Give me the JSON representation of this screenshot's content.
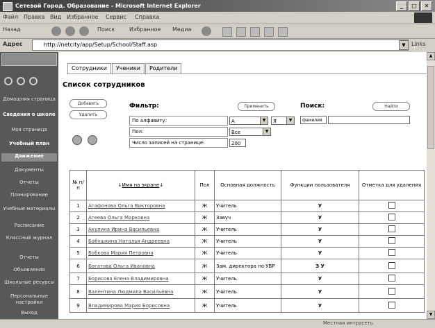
{
  "window": {
    "title": "Сетевой Город. Образование - Microsoft Internet Explorer",
    "min": "_",
    "max": "□",
    "close": "✕"
  },
  "menu": [
    "Файл",
    "Правка",
    "Вид",
    "Избранное",
    "Сервис",
    "Справка"
  ],
  "toolbar": {
    "back": "Назад",
    "search": "Поиск",
    "favorites": "Избранное",
    "media": "Медиа"
  },
  "address": {
    "label": "Адрес",
    "url": "http://netcity/app/Setup/School/Staff.asp",
    "go": "Links"
  },
  "sidebar": {
    "items": [
      {
        "label": "Домашняя страница"
      },
      {
        "label": "Сведения о школе"
      },
      {
        "label": "Моя страница"
      },
      {
        "label": "Учебный план"
      },
      {
        "label": "Движение"
      },
      {
        "label": "Документы"
      },
      {
        "label": "Отчеты"
      },
      {
        "label": "Планирование"
      },
      {
        "label": "Учебные материалы"
      },
      {
        "label": "Расписание"
      },
      {
        "label": "Классный журнал"
      },
      {
        "label": "Отчеты"
      },
      {
        "label": "Объявления"
      },
      {
        "label": "Школьные ресурсы"
      },
      {
        "label": "Персональные настройки"
      },
      {
        "label": "Выход"
      }
    ]
  },
  "tabs": [
    "Сотрудники",
    "Ученики",
    "Родители"
  ],
  "page": {
    "title": "Список сотрудников",
    "buttons": {
      "add": "Добавить",
      "delete": "Удалить",
      "apply": "Применить",
      "find": "Найти"
    },
    "filter": {
      "label": "Фильтр:",
      "alphabet_label": "По алфавиту:",
      "alphabet_from": "А",
      "alphabet_to": "Я",
      "sex_label": "Пол:",
      "sex_value": "Все",
      "rows_label": "Число записей на странице:",
      "rows_value": "200"
    },
    "search": {
      "label": "Поиск:",
      "field_select": "фамилия",
      "field_value": ""
    }
  },
  "table": {
    "headers": {
      "num": "№ п/п",
      "name": "Имя на экране",
      "sex": "Пол",
      "position": "Основная должность",
      "functions": "Функции пользователя",
      "delete": "Отметка для удаления"
    },
    "rows": [
      {
        "num": "1",
        "name": "Агафонова Ольга Викторовна",
        "sex": "Ж",
        "position": "Учитель",
        "func": "У"
      },
      {
        "num": "2",
        "name": "Агеева Ольга Марковна",
        "sex": "Ж",
        "position": "Завуч",
        "func": "У"
      },
      {
        "num": "3",
        "name": "Акулина Ирина Васильевна",
        "sex": "Ж",
        "position": "Учитель",
        "func": "У"
      },
      {
        "num": "4",
        "name": "Бабушкина Наталья Андреевна",
        "sex": "Ж",
        "position": "Учитель",
        "func": "У"
      },
      {
        "num": "5",
        "name": "Бобкова Мария Петровна",
        "sex": "Ж",
        "position": "Учитель",
        "func": "У"
      },
      {
        "num": "6",
        "name": "Богатова Ольга Ивановна",
        "sex": "Ж",
        "position": "Зам. директора по УВР",
        "func": "З У"
      },
      {
        "num": "7",
        "name": "Борисова Елена Владимировна",
        "sex": "Ж",
        "position": "Учитель",
        "func": "У"
      },
      {
        "num": "8",
        "name": "Валентина Людмила Васильевна",
        "sex": "Ж",
        "position": "Учитель",
        "func": "У"
      },
      {
        "num": "9",
        "name": "Владимирова Мария Борисовна",
        "sex": "Ж",
        "position": "Учитель",
        "func": "У"
      }
    ]
  },
  "status": {
    "zone": "Местная интрасеть"
  }
}
